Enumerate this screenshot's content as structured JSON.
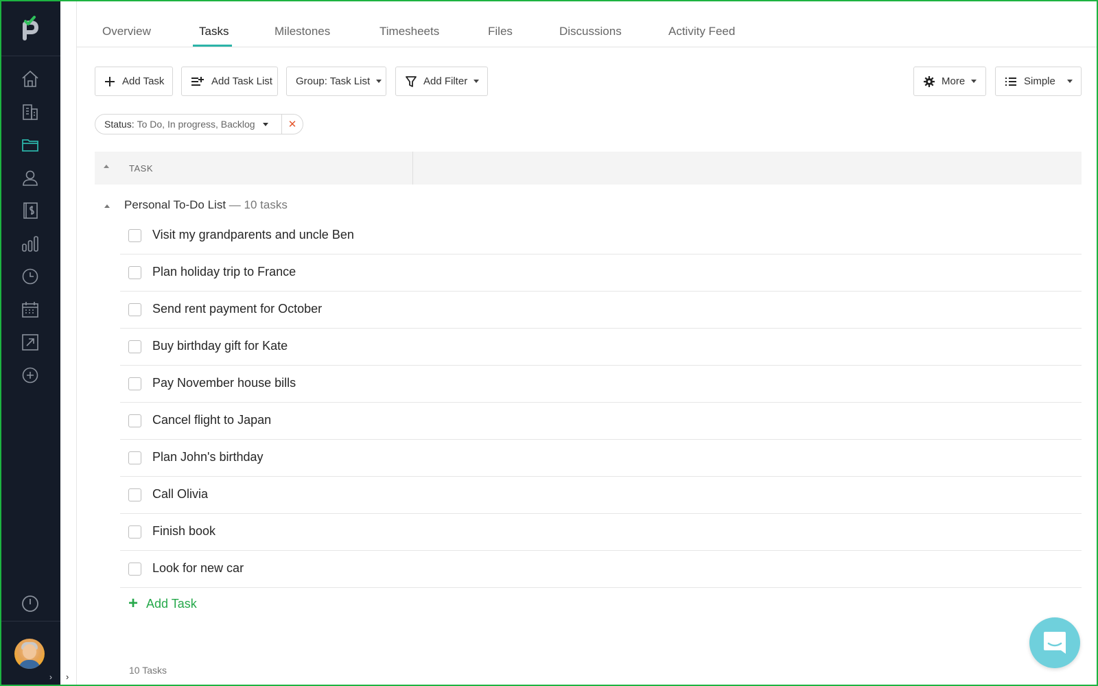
{
  "colors": {
    "sidebar_bg": "#141b28",
    "accent_teal": "#2bb4a8",
    "accent_green": "#25a84a",
    "remove_red": "#e4572e",
    "chat_bubble": "#6fd0dc"
  },
  "sidebar": {
    "logo_icon": "p-logo-icon",
    "items": [
      {
        "name": "home",
        "icon": "home-icon"
      },
      {
        "name": "companies",
        "icon": "building-icon"
      },
      {
        "name": "projects",
        "icon": "folder-icon",
        "active": true
      },
      {
        "name": "people",
        "icon": "user-icon"
      },
      {
        "name": "invoices",
        "icon": "dollar-ledger-icon"
      },
      {
        "name": "reports",
        "icon": "bar-chart-icon"
      },
      {
        "name": "time",
        "icon": "clock-icon"
      },
      {
        "name": "calendar",
        "icon": "calendar-icon"
      },
      {
        "name": "open",
        "icon": "external-arrow-icon"
      },
      {
        "name": "add",
        "icon": "plus-circle-icon"
      }
    ],
    "timer_icon": "power-clock-icon",
    "expand_glyph": "›"
  },
  "collapse_glyph": "›",
  "tabs": [
    {
      "label": "Overview"
    },
    {
      "label": "Tasks",
      "active": true
    },
    {
      "label": "Milestones"
    },
    {
      "label": "Timesheets"
    },
    {
      "label": "Files"
    },
    {
      "label": "Discussions"
    },
    {
      "label": "Activity Feed"
    }
  ],
  "toolbar": {
    "add_task": "Add Task",
    "add_task_list": "Add Task List",
    "group": "Group: Task List",
    "add_filter": "Add Filter",
    "more": "More",
    "view": "Simple"
  },
  "filter_chip": {
    "key": "Status:",
    "value": "To Do, In progress, Backlog",
    "remove_glyph": "✕"
  },
  "table": {
    "column_task": "TASK"
  },
  "group": {
    "title": "Personal To-Do List",
    "count": "— 10 tasks",
    "tasks": [
      "Visit my grandparents and uncle Ben",
      "Plan holiday trip to France",
      "Send rent payment for October",
      "Buy birthday gift for Kate",
      "Pay November house bills",
      "Cancel flight to Japan",
      "Plan John's birthday",
      "Call Olivia",
      "Finish book",
      "Look for new car"
    ],
    "add_task": "Add Task",
    "add_glyph": "+"
  },
  "footer": {
    "count": "10 Tasks"
  }
}
